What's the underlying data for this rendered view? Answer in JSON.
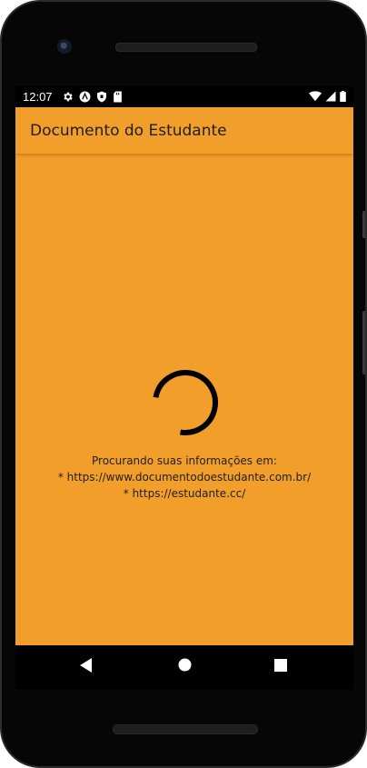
{
  "status_bar": {
    "time": "12:07",
    "left_icons": [
      "settings-icon",
      "a-badge-icon",
      "shield-icon",
      "sd-card-icon"
    ],
    "right_icons": [
      "wifi-icon",
      "signal-icon",
      "battery-icon"
    ]
  },
  "app_bar": {
    "title": "Documento do Estudante"
  },
  "loading": {
    "lines": [
      "Procurando suas informações em:",
      "* https://www.documentodoestudante.com.br/",
      "* https://estudante.cc/"
    ]
  },
  "nav_bar": {
    "buttons": [
      "back-icon",
      "home-icon",
      "recents-icon"
    ]
  },
  "colors": {
    "app_bar": "#f19e2a",
    "background": "#f19e2a",
    "text": "#1f1f1f",
    "spinner": "#000000"
  }
}
